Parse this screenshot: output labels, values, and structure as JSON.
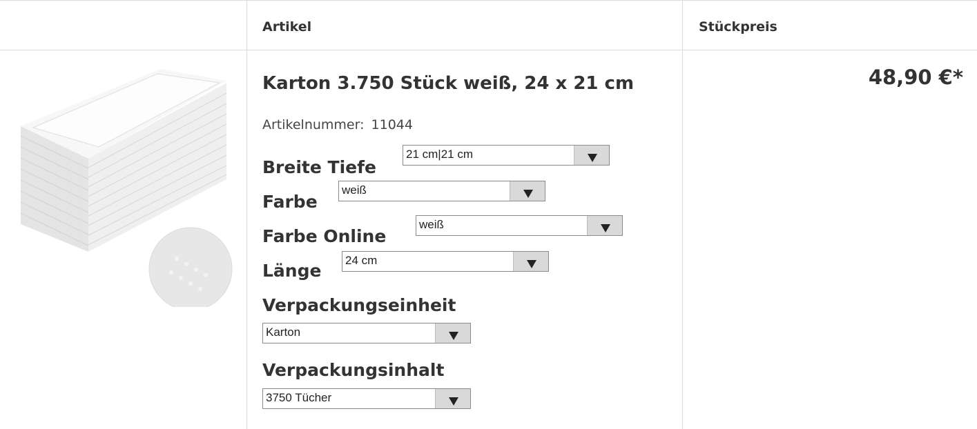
{
  "table": {
    "col_article": "Artikel",
    "col_unit_price": "Stückpreis"
  },
  "product": {
    "image_alt": "Falthandtücher Karton weiß",
    "title": "Karton 3.750 Stück weiß, 24 x 21 cm",
    "article_number_label": "Artikelnummer:",
    "article_number": "11044",
    "price": "48,90 €*"
  },
  "options": {
    "breite_tiefe": {
      "label": "Breite Tiefe",
      "value": "21 cm|21 cm"
    },
    "farbe": {
      "label": "Farbe",
      "value": "weiß"
    },
    "farbe_online": {
      "label": "Farbe Online",
      "value": "weiß"
    },
    "laenge": {
      "label": "Länge",
      "value": "24 cm"
    },
    "verpackungseinheit": {
      "label": "Verpackungseinheit",
      "value": "Karton"
    },
    "verpackungsinhalt": {
      "label": "Verpackungsinhalt",
      "value": "3750 Tücher"
    }
  },
  "icons": {
    "dropdown": "chevron-down-icon"
  },
  "colors": {
    "border": "#dcdcdc",
    "select_arrow_bg": "#d9d9d9",
    "text": "#333333"
  }
}
